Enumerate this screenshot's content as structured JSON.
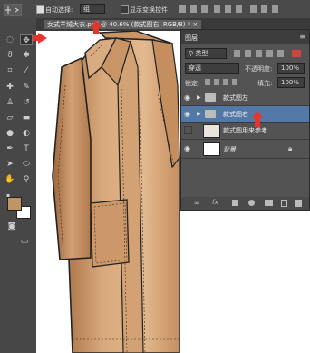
{
  "options_bar": {
    "auto_select_label": "自动选择:",
    "auto_select_value": "组",
    "show_transform_label": "显示变换控件"
  },
  "document": {
    "tab_title": "女式羊绒大衣.psd @ 40.6% (款式图右, RGB/8) *",
    "tab_close": "×"
  },
  "layers_panel": {
    "title": "图层",
    "filter_label": "类型",
    "blend_mode": "穿透",
    "opacity_label": "不透明度:",
    "opacity_value": "100%",
    "lock_label": "锁定:",
    "fill_label": "填充:",
    "fill_value": "100%",
    "layers": [
      {
        "name": "款式图左",
        "kind": "group",
        "visible": true,
        "selected": false
      },
      {
        "name": "款式图右",
        "kind": "group",
        "visible": true,
        "selected": true
      },
      {
        "name": "款式图用来参考",
        "kind": "layer",
        "visible": false,
        "selected": false
      },
      {
        "name": "背景",
        "kind": "background",
        "visible": true,
        "selected": false,
        "locked": true
      }
    ],
    "footer_icons": [
      "link-icon",
      "fx-icon",
      "mask-icon",
      "adjustment-icon",
      "folder-icon",
      "new-layer-icon",
      "trash-icon"
    ],
    "fx_label": "fx"
  },
  "colors": {
    "coat": "#d6a679",
    "coat_dark": "#b98457",
    "selection": "#5278a8",
    "annotation": "#e8332b",
    "foreground_swatch": "#c19563"
  },
  "annotations": [
    "red-arrow-move-tool",
    "red-arrow-document-tab",
    "red-arrow-layer-selected"
  ]
}
